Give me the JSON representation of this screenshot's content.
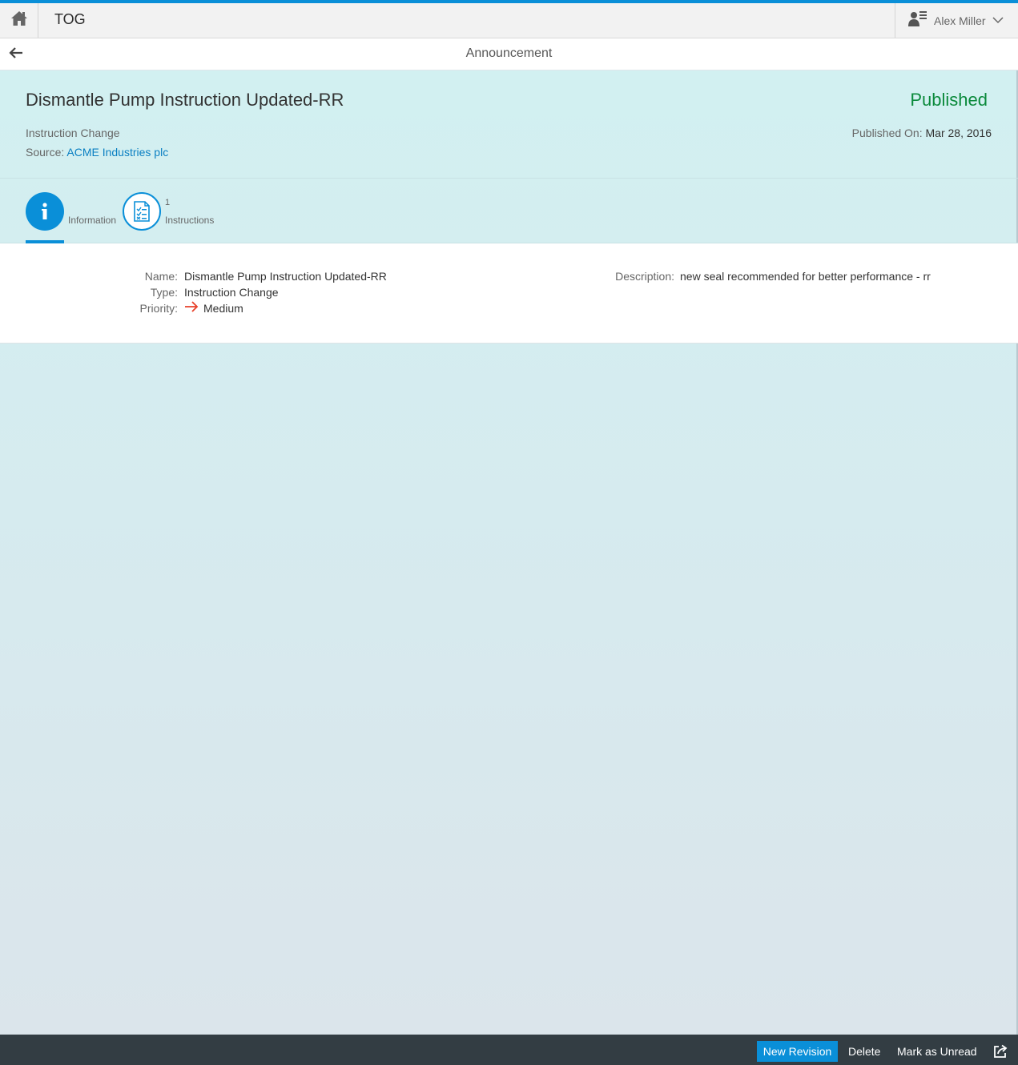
{
  "shell": {
    "app_title": "TOG",
    "user_name": "Alex Miller"
  },
  "subheader": {
    "title": "Announcement"
  },
  "object_header": {
    "title": "Dismantle Pump Instruction Updated-RR",
    "status": "Published",
    "status_color": "#0b8a3c",
    "category": "Instruction Change",
    "source_label": "Source:",
    "source_value": "ACME Industries plc",
    "published_label": "Published On:",
    "published_value": "Mar 28, 2016"
  },
  "tabs": [
    {
      "label": "Information",
      "icon": "info-icon",
      "selected": true
    },
    {
      "label": "Instructions",
      "count": "1",
      "icon": "checklist-document-icon",
      "selected": false
    }
  ],
  "info": {
    "name_label": "Name:",
    "name_value": "Dismantle Pump Instruction Updated-RR",
    "type_label": "Type:",
    "type_value": "Instruction Change",
    "priority_label": "Priority:",
    "priority_value": "Medium",
    "priority_icon": "right-arrow-icon",
    "description_label": "Description:",
    "description_value": "new seal recommended for better performance - rr"
  },
  "footer": {
    "new_revision": "New Revision",
    "delete": "Delete",
    "mark_unread": "Mark as Unread",
    "share_icon": "share-icon"
  },
  "colors": {
    "accent": "#0a8fd8",
    "priority_arrow": "#e8412a",
    "footer_bg": "#333d43"
  }
}
